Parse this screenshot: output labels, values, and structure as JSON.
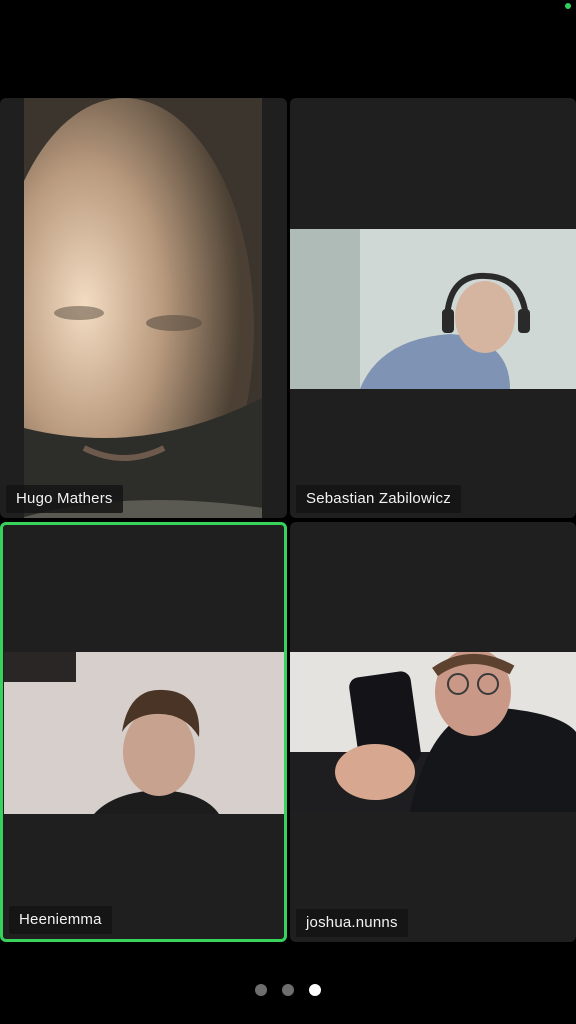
{
  "participants": [
    {
      "name": "Hugo Mathers",
      "active": false
    },
    {
      "name": "Sebastian Zabilowicz",
      "active": false
    },
    {
      "name": "Heeniemma",
      "active": true
    },
    {
      "name": "joshua.nunns",
      "active": false
    }
  ],
  "pager": {
    "page_count": 3,
    "current_page": 3
  },
  "colors": {
    "active_border": "#37d25c",
    "status_dot": "#2fd15a",
    "tile_bg": "#1f1f1f"
  }
}
